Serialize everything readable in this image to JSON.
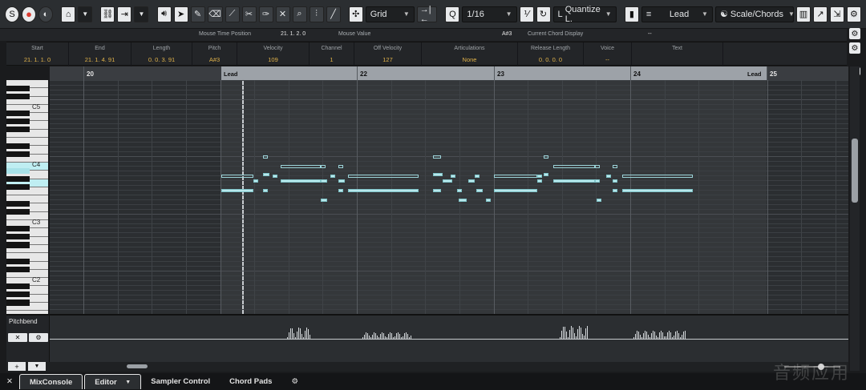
{
  "toolbar": {
    "solo": "S",
    "record": "●",
    "grid_type": "Grid",
    "quantize_value": "1/16",
    "quantize_mode": "Quantize L.",
    "track": "Lead",
    "scale_chords": "Scale/Chords"
  },
  "infoline": {
    "mouse_time_label": "Mouse Time Position",
    "mouse_time_value": "21. 1. 2.  0",
    "mouse_value_label": "Mouse Value",
    "mouse_value": "A#3",
    "chord_label": "Current Chord Display",
    "chord_value": "--"
  },
  "status": [
    {
      "label": "Start",
      "value": "21. 1. 1.   0"
    },
    {
      "label": "End",
      "value": "21. 1. 4. 91"
    },
    {
      "label": "Length",
      "value": "0. 0. 3. 91"
    },
    {
      "label": "Pitch",
      "value": "A#3"
    },
    {
      "label": "Velocity",
      "value": "109"
    },
    {
      "label": "Channel",
      "value": "1"
    },
    {
      "label": "Off Velocity",
      "value": "127"
    },
    {
      "label": "Articulations",
      "value": "None"
    },
    {
      "label": "Release Length",
      "value": "0. 0. 0. 0"
    },
    {
      "label": "Voice",
      "value": "--"
    },
    {
      "label": "Text",
      "value": ""
    }
  ],
  "ruler": {
    "bars": [
      "20",
      "22",
      "23",
      "24",
      "25"
    ],
    "part_name": "Lead"
  },
  "keyboard": {
    "labels": [
      "C5",
      "C4",
      "C3",
      "C2"
    ]
  },
  "lane": {
    "title": "Pitchbend",
    "btn1": "✕",
    "btn2": "⚙"
  },
  "tabs": {
    "close": "✕",
    "mixconsole": "MixConsole",
    "editor": "Editor",
    "sampler": "Sampler Control",
    "chordpads": "Chord Pads",
    "gear": "⚙"
  },
  "watermark": "音频应用",
  "icons": [
    "solo-icon",
    "record-icon",
    "monitor-icon",
    "autoscroll-icon",
    "link-icon",
    "arrow-icon",
    "pencil-icon",
    "eraser-icon",
    "scissors-icon",
    "glue-icon",
    "mute-icon",
    "zoom-icon",
    "line-icon",
    "gear-icon"
  ],
  "colors": {
    "accent": "#e0b24a",
    "note": "#b9e8ec",
    "record": "#d93a2f"
  }
}
